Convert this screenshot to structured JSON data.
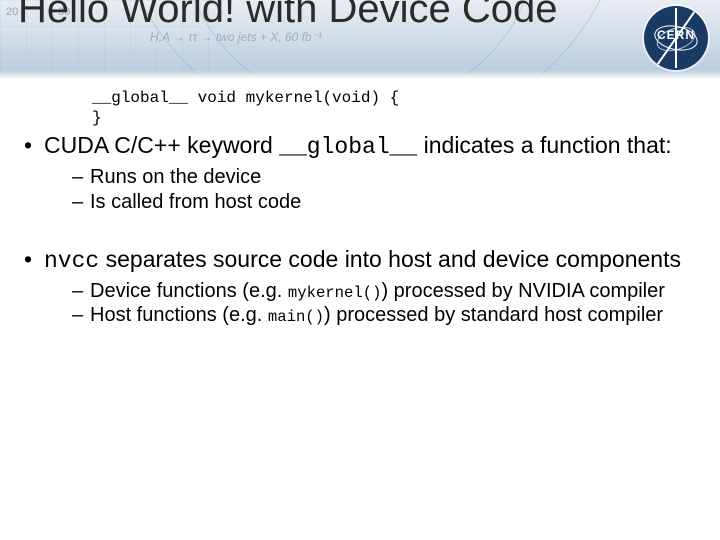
{
  "banner": {
    "tick1": "20",
    "tick2": "30",
    "formula": "H,A → ττ → two jets + X, 60 fb⁻¹",
    "logo_text": "CERN"
  },
  "title": "Hello World! with Device Code",
  "code": {
    "line1": "__global__ void mykernel(void) {",
    "line2": "}"
  },
  "bullets": {
    "b1_pre": "CUDA C/C++ keyword ",
    "b1_code": "__global__",
    "b1_post": " indicates a function that:",
    "b1_sub1": "Runs on the device",
    "b1_sub2": "Is called from host code",
    "b2_code": "nvcc",
    "b2_post": " separates source code into host and device components",
    "b2_sub1_pre": "Device functions (e.g. ",
    "b2_sub1_code": "mykernel()",
    "b2_sub1_post": ") processed by NVIDIA compiler",
    "b2_sub2_pre": "Host functions (e.g. ",
    "b2_sub2_code": "main()",
    "b2_sub2_post": ") processed by standard host compiler"
  }
}
